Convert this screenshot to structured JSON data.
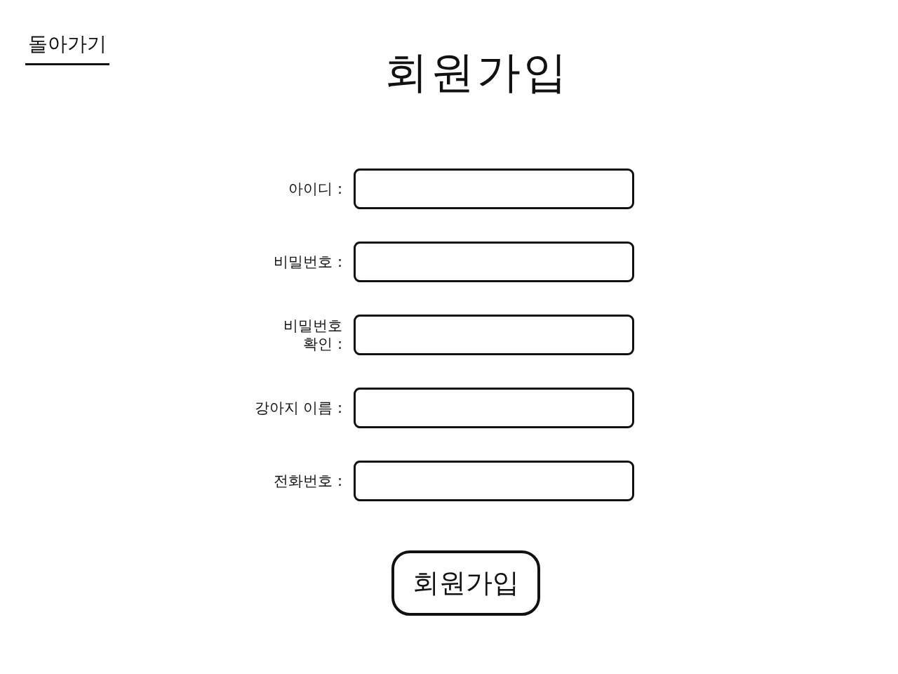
{
  "back_link": {
    "label": "돌아가기"
  },
  "title": "회원가입",
  "fields": [
    {
      "label": "아이디 :"
    },
    {
      "label": "비밀번호 :"
    },
    {
      "label": "비밀번호 확인 :"
    },
    {
      "label": "강아지 이름 :"
    },
    {
      "label": "전화번호 :"
    }
  ],
  "submit_button": {
    "label": "회원가입"
  }
}
